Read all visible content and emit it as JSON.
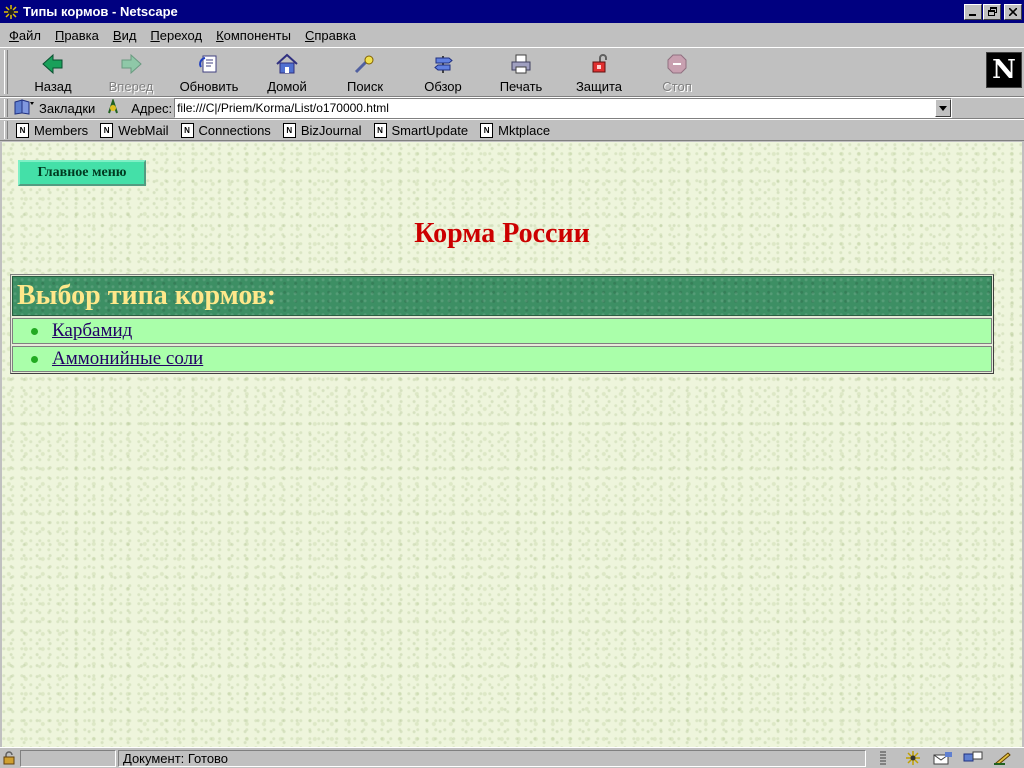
{
  "window": {
    "title": "Типы кормов - Netscape"
  },
  "menu": [
    {
      "label": "Файл",
      "accel": "Ф",
      "rest": "айл"
    },
    {
      "label": "Правка",
      "accel": "П",
      "rest": "равка"
    },
    {
      "label": "Вид",
      "accel": "В",
      "rest": "ид"
    },
    {
      "label": "Переход",
      "accel": "П",
      "rest": "ереход"
    },
    {
      "label": "Компоненты",
      "accel": "К",
      "rest": "омпоненты"
    },
    {
      "label": "Справка",
      "accel": "С",
      "rest": "правка"
    }
  ],
  "toolbar": {
    "back": "Назад",
    "forward": "Вперед",
    "reload": "Обновить",
    "home": "Домой",
    "search": "Поиск",
    "guide": "Обзор",
    "print": "Печать",
    "security": "Защита",
    "stop": "Стоп"
  },
  "location": {
    "bookmarks_label": "Закладки",
    "address_label": "Адрес:",
    "url": "file:///C|/Priem/Korma/List/o170000.html"
  },
  "personal_toolbar": [
    "Members",
    "WebMail",
    "Connections",
    "BizJournal",
    "SmartUpdate",
    "Mktplace"
  ],
  "content": {
    "main_menu_button": "Главное меню",
    "page_title": "Корма России",
    "section_header": "Выбор типа кормов:",
    "links": [
      "Карбамид",
      "Аммонийные соли"
    ]
  },
  "status": {
    "text": "Документ: Готово"
  },
  "colors": {
    "title_bar": "#000080",
    "page_title": "#cc0000",
    "header_bg": "#3d8f64",
    "header_text": "#ffe88a",
    "row_bg": "#aaffaa",
    "button_bg": "#44e0a8"
  }
}
